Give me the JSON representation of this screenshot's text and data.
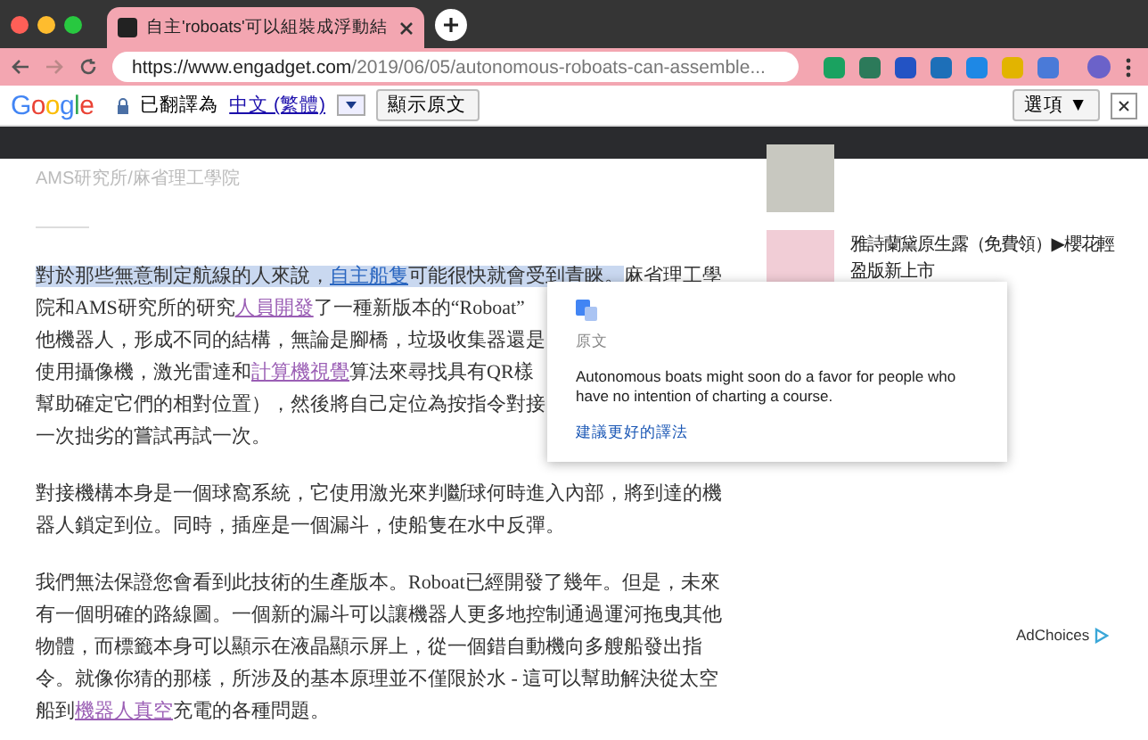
{
  "browser": {
    "tab": {
      "title": "自主'roboats'可以組裝成浮動結"
    },
    "url": {
      "host": "https://www.engadget.com",
      "path": "/2019/06/05/autonomous-roboats-can-assemble..."
    }
  },
  "translate_bar": {
    "logo": "Google",
    "status": "已翻譯為",
    "language": "中文 (繁體)",
    "show_original_button": "顯示原文",
    "options_button": "選項 ▼"
  },
  "article": {
    "caption": "AMS研究所/麻省理工學院",
    "paragraphs": [
      {
        "lines": [
          [
            {
              "kind": "text",
              "text": "對於那些無意制定航線的人來說，",
              "highlighted": true
            },
            {
              "kind": "link",
              "text": "自主船隻",
              "highlighted": true
            },
            {
              "kind": "text",
              "text": "可能很快就會受到青睞。",
              "highlighted": true
            },
            {
              "kind": "text",
              "text": "麻省理工學",
              "highlighted": false
            }
          ],
          [
            {
              "kind": "text",
              "text": "院和AMS研究所的研究",
              "highlighted": false
            },
            {
              "kind": "visited-link",
              "text": "人員開發",
              "highlighted": false
            },
            {
              "kind": "text",
              "text": "了一種新版本的“Roboat”",
              "highlighted": false
            }
          ],
          [
            {
              "kind": "text",
              "text": "他機器人，形成不同的結構，無論是腳橋，垃圾收集器還是",
              "highlighted": false
            }
          ],
          [
            {
              "kind": "text",
              "text": "使用攝像機，激光雷達和",
              "highlighted": false
            },
            {
              "kind": "visited-link",
              "text": "計算機視覺",
              "highlighted": false
            },
            {
              "kind": "text",
              "text": "算法來尋找具有QR樣",
              "highlighted": false
            }
          ],
          [
            {
              "kind": "text",
              "text": "幫助確定它們的相對位置），然後將自己定位為按指令對接",
              "highlighted": false
            }
          ],
          [
            {
              "kind": "text",
              "text": "一次拙劣的嘗試再試一次。",
              "highlighted": false
            }
          ]
        ]
      },
      {
        "lines": [
          [
            {
              "kind": "text",
              "text": "對接機構本身是一個球窩系統，它使用激光來判斷球何時進入內部，將到達的機",
              "highlighted": false
            }
          ],
          [
            {
              "kind": "text",
              "text": "器人鎖定到位。同時，插座是一個漏斗，使船隻在水中反彈。",
              "highlighted": false
            }
          ]
        ]
      },
      {
        "lines": [
          [
            {
              "kind": "text",
              "text": "我們無法保證您會看到此技術的生產版本。Roboat已經開發了幾年。但是，未來",
              "highlighted": false
            }
          ],
          [
            {
              "kind": "text",
              "text": "有一個明確的路線圖。一個新的漏斗可以讓機器人更多地控制通過運河拖曳其他",
              "highlighted": false
            }
          ],
          [
            {
              "kind": "text",
              "text": "物體，而標籤本身可以顯示在液晶顯示屏上，從一個錯自動機向多艘船發出指",
              "highlighted": false
            }
          ],
          [
            {
              "kind": "text",
              "text": "令。就像你猜的那樣，所涉及的基本原理並不僅限於水 - 這可以幫助解決從太空",
              "highlighted": false
            }
          ],
          [
            {
              "kind": "text",
              "text": "船到",
              "highlighted": false
            },
            {
              "kind": "visited-link",
              "text": "機器人真空",
              "highlighted": false
            },
            {
              "kind": "text",
              "text": "充電的各種問題。",
              "highlighted": false
            }
          ]
        ]
      }
    ]
  },
  "sidebar": {
    "items": [
      {
        "title": "雅詩蘭黛原生露（免費領）▶櫻花輕盈版新上市"
      }
    ],
    "adchoices": "AdChoices"
  },
  "translation_popup": {
    "label": "原文",
    "original_text": "Autonomous boats might soon do a favor for people who have no intention of charting a course.",
    "suggest_link": "建議更好的譯法"
  }
}
